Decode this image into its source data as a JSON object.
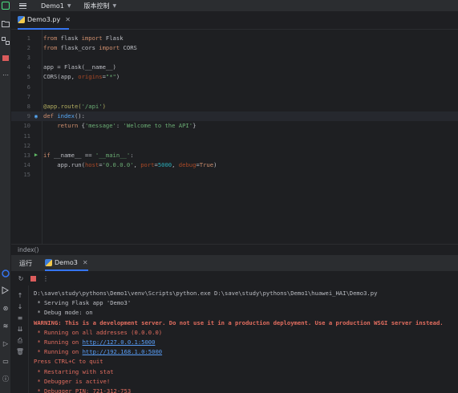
{
  "titlebar": {
    "project": "Demo1",
    "vcs": "版本控制"
  },
  "editor": {
    "tab_label": "Demo3.py",
    "lines": [
      {
        "n": "1",
        "tokens": [
          [
            "kw",
            "from "
          ],
          [
            "plain",
            "flask "
          ],
          [
            "kw",
            "import "
          ],
          [
            "plain",
            "Flask"
          ]
        ]
      },
      {
        "n": "2",
        "tokens": [
          [
            "kw",
            "from "
          ],
          [
            "plain",
            "flask_cors "
          ],
          [
            "kw",
            "import "
          ],
          [
            "plain",
            "CORS"
          ]
        ]
      },
      {
        "n": "3",
        "tokens": []
      },
      {
        "n": "4",
        "tokens": [
          [
            "plain",
            "app = Flask(__name__)"
          ]
        ]
      },
      {
        "n": "5",
        "tokens": [
          [
            "plain",
            "CORS(app, "
          ],
          [
            "param",
            "origins"
          ],
          [
            "plain",
            "="
          ],
          [
            "str",
            "\"*\""
          ],
          [
            "plain",
            ")"
          ]
        ]
      },
      {
        "n": "6",
        "tokens": []
      },
      {
        "n": "7",
        "tokens": []
      },
      {
        "n": "8",
        "tokens": [
          [
            "deco",
            "@app.route("
          ],
          [
            "str",
            "'/api'"
          ],
          [
            "deco",
            ")"
          ]
        ]
      },
      {
        "n": "9",
        "tokens": [
          [
            "kw",
            "def "
          ],
          [
            "fn",
            "index"
          ],
          [
            "plain",
            "():"
          ]
        ]
      },
      {
        "n": "10",
        "tokens": [
          [
            "plain",
            "    "
          ],
          [
            "kw",
            "return "
          ],
          [
            "plain",
            "{"
          ],
          [
            "str",
            "'message'"
          ],
          [
            "plain",
            ": "
          ],
          [
            "str",
            "'Welcome to the API'"
          ],
          [
            "plain",
            "}"
          ]
        ]
      },
      {
        "n": "11",
        "tokens": []
      },
      {
        "n": "12",
        "tokens": []
      },
      {
        "n": "13",
        "tokens": [
          [
            "kw",
            "if "
          ],
          [
            "plain",
            "__name__ == "
          ],
          [
            "str",
            "'__main__'"
          ],
          [
            "plain",
            ":"
          ]
        ]
      },
      {
        "n": "14",
        "tokens": [
          [
            "plain",
            "    app.run("
          ],
          [
            "param",
            "host"
          ],
          [
            "plain",
            "="
          ],
          [
            "str",
            "'0.0.0.0'"
          ],
          [
            "plain",
            ", "
          ],
          [
            "param",
            "port"
          ],
          [
            "plain",
            "="
          ],
          [
            "num",
            "5000"
          ],
          [
            "plain",
            ", "
          ],
          [
            "param",
            "debug"
          ],
          [
            "plain",
            "="
          ],
          [
            "kw",
            "True"
          ],
          [
            "plain",
            ")"
          ]
        ]
      },
      {
        "n": "15",
        "tokens": []
      }
    ]
  },
  "breadcrumb": "index()",
  "run": {
    "title": "运行",
    "tab": "Demo3",
    "console": [
      {
        "style": "c-white",
        "text": "D:\\save\\study\\pythons\\Demo1\\venv\\Scripts\\python.exe D:\\save\\study\\pythons\\Demo1\\huawei_HAI\\Demo3.py"
      },
      {
        "style": "c-white",
        "text": " * Serving Flask app 'Demo3'"
      },
      {
        "style": "c-white",
        "text": " * Debug mode: on"
      },
      {
        "style": "c-redb",
        "text": "WARNING: This is a development server. Do not use it in a production deployment. Use a production WSGI server instead."
      },
      {
        "style": "c-red",
        "text": " * Running on all addresses (0.0.0.0)"
      },
      {
        "style": "c-red",
        "text": " * Running on ",
        "link": "http://127.0.0.1:5000"
      },
      {
        "style": "c-red",
        "text": " * Running on ",
        "link": "http://192.168.1.0:5000"
      },
      {
        "style": "c-red",
        "text": "Press CTRL+C to quit"
      },
      {
        "style": "c-red",
        "text": " * Restarting with stat"
      },
      {
        "style": "c-red",
        "text": " * Debugger is active!"
      },
      {
        "style": "c-red",
        "text": " * Debugger PIN: 721-312-753"
      }
    ]
  }
}
